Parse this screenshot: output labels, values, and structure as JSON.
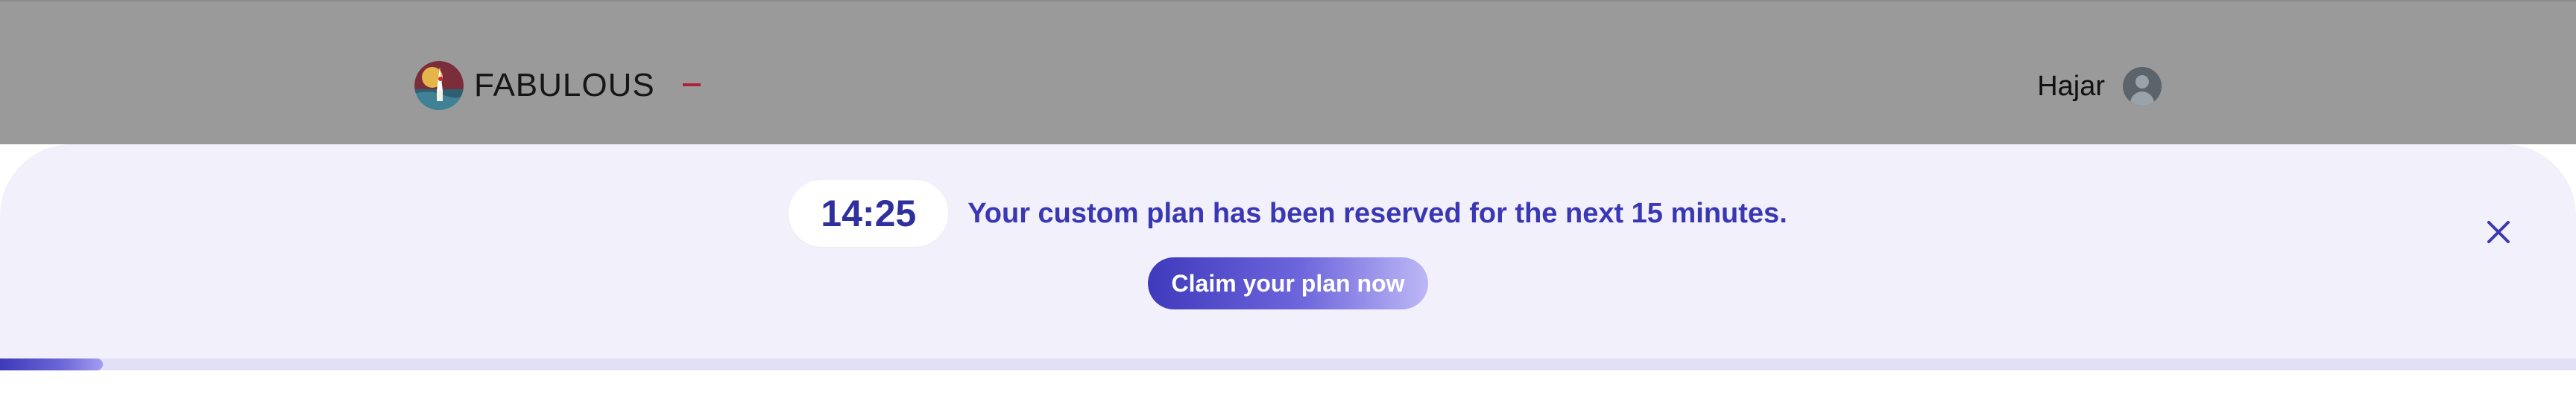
{
  "header": {
    "brand_name": "FABULOUS",
    "user_name": "Hajar"
  },
  "icons": {
    "brand_logo": "fabulous-logo",
    "avatar": "user-avatar-icon",
    "close": "close-icon"
  },
  "banner": {
    "timer": "14:25",
    "message": "Your custom plan has been reserved for the next 15 minutes.",
    "cta_label": "Claim your plan now",
    "progress_fraction": 0.04
  },
  "colors": {
    "accent": "#3a37b5",
    "banner_bg": "#f2f1fb",
    "header_dim": "#9a9a9a",
    "progress_track": "#e1e0f7"
  }
}
